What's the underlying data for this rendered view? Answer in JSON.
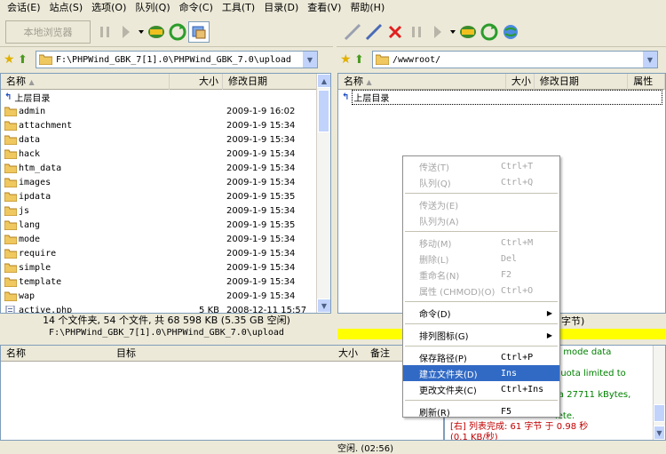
{
  "menubar": [
    "会话(E)",
    "站点(S)",
    "选项(O)",
    "队列(Q)",
    "命令(C)",
    "工具(T)",
    "目录(D)",
    "查看(V)",
    "帮助(H)"
  ],
  "toolbar": {
    "local_browser": "本地浏览器"
  },
  "left": {
    "path": "F:\\PHPWind_GBK_7[1].0\\PHPWind_GBK_7.0\\upload",
    "headers": {
      "name": "名称",
      "size": "大小",
      "date": "修改日期"
    },
    "up_label": "上层目录",
    "files": [
      {
        "name": "admin",
        "size": "",
        "date": "2009-1-9 16:02"
      },
      {
        "name": "attachment",
        "size": "",
        "date": "2009-1-9 15:34"
      },
      {
        "name": "data",
        "size": "",
        "date": "2009-1-9 15:34"
      },
      {
        "name": "hack",
        "size": "",
        "date": "2009-1-9 15:34"
      },
      {
        "name": "htm_data",
        "size": "",
        "date": "2009-1-9 15:34"
      },
      {
        "name": "images",
        "size": "",
        "date": "2009-1-9 15:34"
      },
      {
        "name": "ipdata",
        "size": "",
        "date": "2009-1-9 15:35"
      },
      {
        "name": "js",
        "size": "",
        "date": "2009-1-9 15:34"
      },
      {
        "name": "lang",
        "size": "",
        "date": "2009-1-9 15:35"
      },
      {
        "name": "mode",
        "size": "",
        "date": "2009-1-9 15:34"
      },
      {
        "name": "require",
        "size": "",
        "date": "2009-1-9 15:34"
      },
      {
        "name": "simple",
        "size": "",
        "date": "2009-1-9 15:34"
      },
      {
        "name": "template",
        "size": "",
        "date": "2009-1-9 15:34"
      },
      {
        "name": "wap",
        "size": "",
        "date": "2009-1-9 15:34"
      },
      {
        "name": "active.php",
        "size": "5 KB",
        "date": "2008-12-11 15:57"
      }
    ],
    "status_line1": "14 个文件夹, 54 个文件, 共 68 598 KB (5.35 GB 空闲)",
    "status_line2": "F:\\PHPWind_GBK_7[1].0\\PHPWind_GBK_7.0\\upload"
  },
  "right": {
    "path": "/wwwroot/",
    "headers": {
      "name": "名称",
      "size": "大小",
      "date": "修改日期",
      "attr": "属性"
    },
    "up_label": "上层目录",
    "status_tail": "字节)"
  },
  "queue": {
    "headers": {
      "name": "名称",
      "target": "目标",
      "size": "大小",
      "note": "备注"
    }
  },
  "log": {
    "lines": [
      "Y mode data",
      "",
      "quota limited to",
      "",
      "ta 27711 kBytes,",
      "s",
      "lete."
    ],
    "red1": "[右] 列表完成: 61 字节 于 0.98 秒",
    "red2": "(0.1 KB/秒)"
  },
  "bottom_status": "空闲. (02:56)",
  "context_menu": [
    {
      "label": "传送(T)",
      "shortcut": "Ctrl+T",
      "disabled": true
    },
    {
      "label": "队列(Q)",
      "shortcut": "Ctrl+Q",
      "disabled": true
    },
    {
      "sep": true
    },
    {
      "label": "传送为(E)",
      "shortcut": "",
      "disabled": true
    },
    {
      "label": "队列为(A)",
      "shortcut": "",
      "disabled": true
    },
    {
      "sep": true
    },
    {
      "label": "移动(M)",
      "shortcut": "Ctrl+M",
      "disabled": true
    },
    {
      "label": "删除(L)",
      "shortcut": "Del",
      "disabled": true
    },
    {
      "label": "重命名(N)",
      "shortcut": "F2",
      "disabled": true
    },
    {
      "label": "属性 (CHMOD)(O)",
      "shortcut": "Ctrl+O",
      "disabled": true
    },
    {
      "sep": true
    },
    {
      "label": "命令(D)",
      "shortcut": "",
      "submenu": true
    },
    {
      "sep": true
    },
    {
      "label": "排列图标(G)",
      "shortcut": "",
      "submenu": true
    },
    {
      "sep": true
    },
    {
      "label": "保存路径(P)",
      "shortcut": "Ctrl+P"
    },
    {
      "label": "建立文件夹(D)",
      "shortcut": "Ins",
      "highlight": true
    },
    {
      "label": "更改文件夹(C)",
      "shortcut": "Ctrl+Ins"
    },
    {
      "sep": true
    },
    {
      "label": "刷新(R)",
      "shortcut": "F5"
    }
  ]
}
